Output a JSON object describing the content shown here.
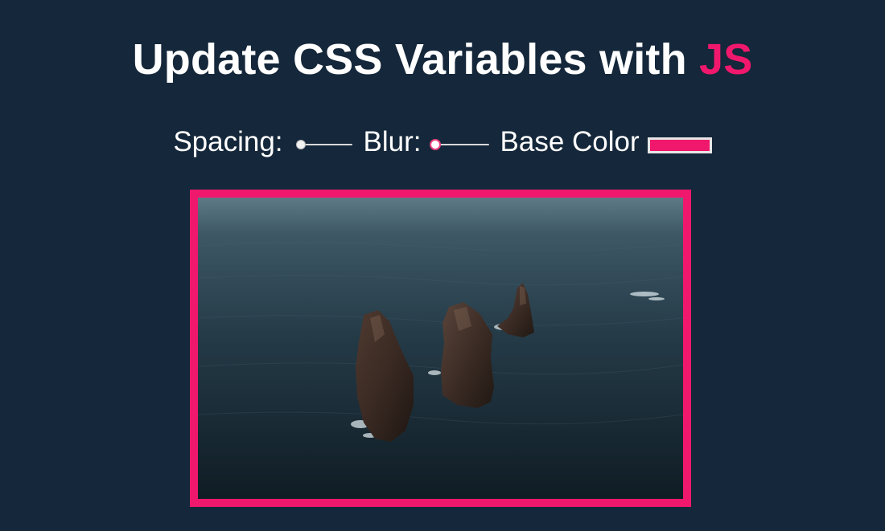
{
  "header": {
    "title_main": "Update CSS Variables with ",
    "title_highlight": "JS"
  },
  "controls": {
    "spacing_label": "Spacing:",
    "spacing_value": 0.05,
    "blur_label": "Blur:",
    "blur_value": 0,
    "base_color_label": "Base Color",
    "base_color": "#f0186d"
  },
  "colors": {
    "background": "#15273a",
    "accent": "#f0186d",
    "text": "#ffffff"
  },
  "image": {
    "subject": "aerial-photo-sea-rock-stacks"
  }
}
